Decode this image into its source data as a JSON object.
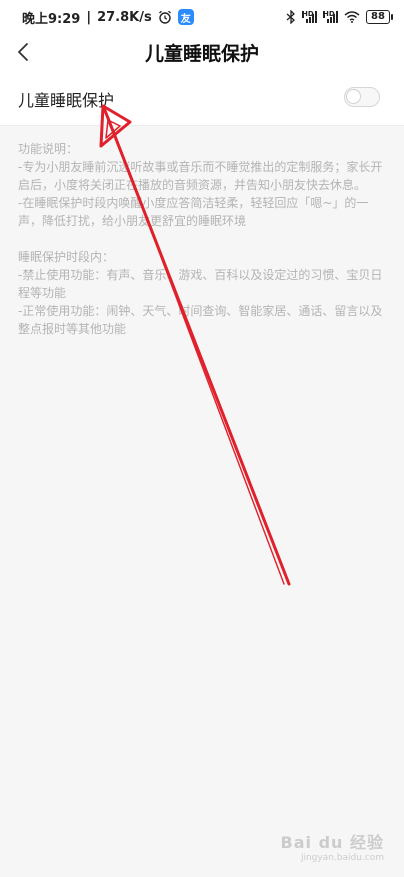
{
  "status_bar": {
    "time": "晚上9:29",
    "speed": "27.8K/s",
    "app_badge": "友",
    "sim1_label": "HD",
    "sim2_label": "HD",
    "battery": "88"
  },
  "header": {
    "title": "儿童睡眠保护"
  },
  "setting": {
    "label": "儿童睡眠保护",
    "enabled": false
  },
  "description": {
    "section1_heading": "功能说明：",
    "section1_line1": "-专为小朋友睡前沉迷听故事或音乐而不睡觉推出的定制服务；家长开启后，小度将关闭正在播放的音频资源，并告知小朋友快去休息。",
    "section1_line2": "-在睡眠保护时段内唤醒小度应答简洁轻柔，轻轻回应「嗯~」的一声，降低打扰，给小朋友更舒宜的睡眠环境",
    "section2_heading": "睡眠保护时段内：",
    "section2_line1": "-禁止使用功能：有声、音乐、游戏、百科以及设定过的习惯、宝贝日程等功能",
    "section2_line2": "-正常使用功能：闹钟、天气、时间查询、智能家居、通话、留言以及整点报时等其他功能"
  },
  "watermark": {
    "brand": "Bai du 经验",
    "sub": "jingyan.baidu.com"
  },
  "colors": {
    "annotation_arrow": "#e0202a",
    "description_text": "#b4b4b4"
  }
}
